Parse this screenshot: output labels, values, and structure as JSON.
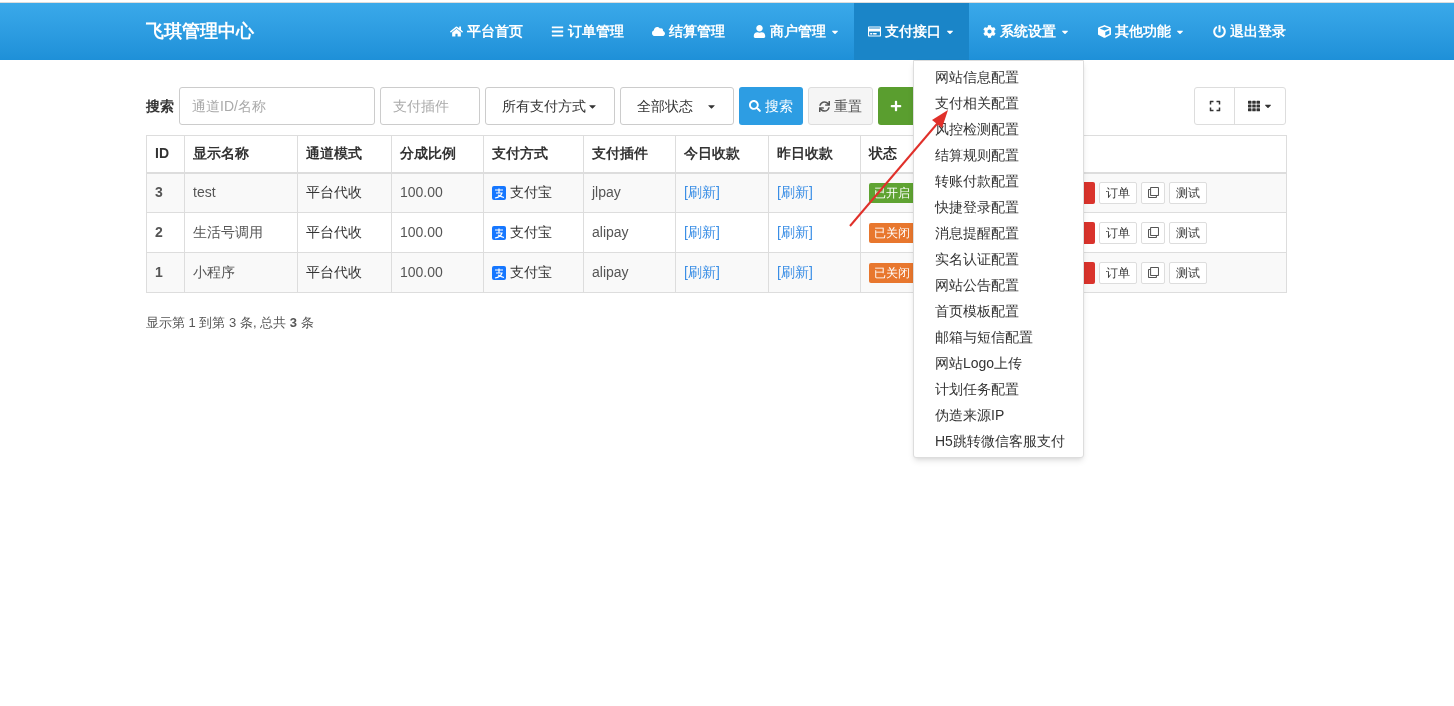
{
  "navbar": {
    "brand": "飞琪管理中心",
    "items": [
      {
        "kind": "home",
        "label": "平台首页",
        "dropdown": false,
        "selected": false
      },
      {
        "kind": "list",
        "label": "订单管理",
        "dropdown": false,
        "selected": false
      },
      {
        "kind": "cloud",
        "label": "结算管理",
        "dropdown": false,
        "selected": false
      },
      {
        "kind": "user",
        "label": "商户管理",
        "dropdown": true,
        "selected": false
      },
      {
        "kind": "card",
        "label": "支付接口",
        "dropdown": true,
        "selected": true
      },
      {
        "kind": "gear",
        "label": "系统设置",
        "dropdown": true,
        "selected": false
      },
      {
        "kind": "cube",
        "label": "其他功能",
        "dropdown": true,
        "selected": false
      },
      {
        "kind": "power",
        "label": "退出登录",
        "dropdown": false,
        "selected": false
      }
    ]
  },
  "dropdown_menu": [
    "网站信息配置",
    "支付相关配置",
    "风控检测配置",
    "结算规则配置",
    "转账付款配置",
    "快捷登录配置",
    "消息提醒配置",
    "实名认证配置",
    "网站公告配置",
    "首页模板配置",
    "邮箱与短信配置",
    "网站Logo上传",
    "计划任务配置",
    "伪造来源IP",
    "H5跳转微信客服支付"
  ],
  "toolbar": {
    "label": "搜索",
    "search": {
      "placeholder": "通道ID/名称"
    },
    "plugin": {
      "placeholder": "支付插件"
    },
    "pay_type": "所有支付方式",
    "status": "全部状态",
    "search_button": "搜索",
    "reset_button": "重置"
  },
  "table": {
    "columns": [
      "ID",
      "显示名称",
      "通道模式",
      "分成比例",
      "支付方式",
      "支付插件",
      "今日收款",
      "昨日收款",
      "状态"
    ],
    "rows": [
      {
        "id": "3",
        "name": "test",
        "mode": "平台代收",
        "rate": "100.00",
        "pay": "支付宝",
        "plugin": "jlpay",
        "today": "[刷新]",
        "yesterday": "[刷新]",
        "status": "已开启",
        "on": true,
        "actions": [
          "订单",
          "测试"
        ]
      },
      {
        "id": "2",
        "name": "生活号调用",
        "mode": "平台代收",
        "rate": "100.00",
        "pay": "支付宝",
        "plugin": "alipay",
        "today": "[刷新]",
        "yesterday": "[刷新]",
        "status": "已关闭",
        "on": false,
        "actions": [
          "订单",
          "测试"
        ]
      },
      {
        "id": "1",
        "name": "小程序",
        "mode": "平台代收",
        "rate": "100.00",
        "pay": "支付宝",
        "plugin": "alipay",
        "today": "[刷新]",
        "yesterday": "[刷新]",
        "status": "已关闭",
        "on": false,
        "actions": [
          "订单",
          "测试"
        ]
      }
    ]
  },
  "pagination": "显示第 1 到第 3 条, 总共 **3** 条"
}
